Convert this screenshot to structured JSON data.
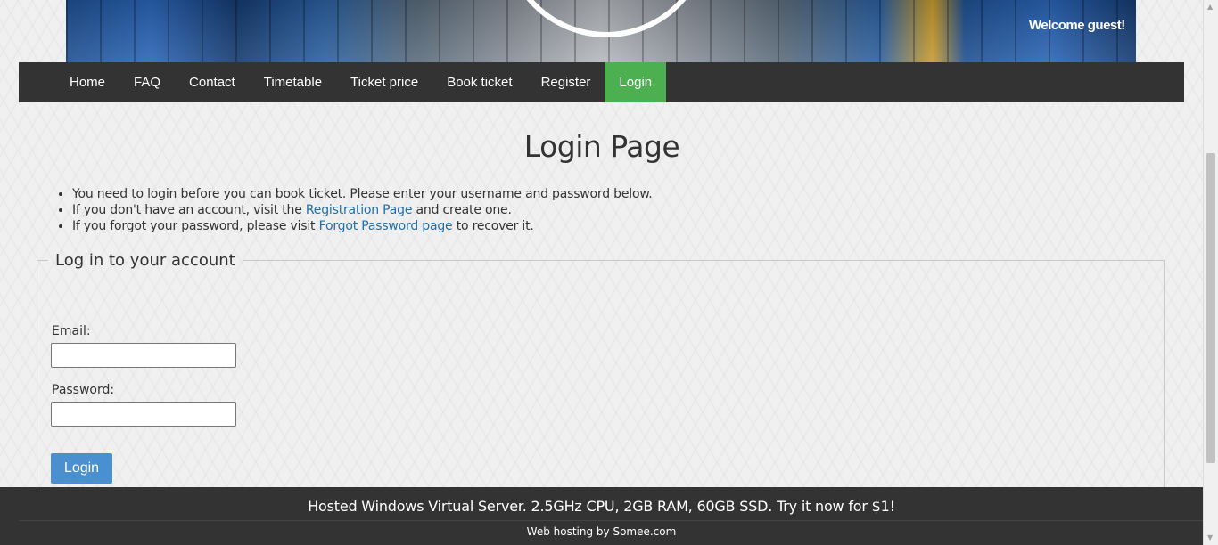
{
  "header": {
    "welcome_text": "Welcome guest!"
  },
  "nav": {
    "items": [
      {
        "label": "Home"
      },
      {
        "label": "FAQ"
      },
      {
        "label": "Contact"
      },
      {
        "label": "Timetable"
      },
      {
        "label": "Ticket price"
      },
      {
        "label": "Book ticket"
      },
      {
        "label": "Register"
      },
      {
        "label": "Login",
        "active": true
      }
    ],
    "active_color": "#4caf50",
    "bar_color": "#333333"
  },
  "main": {
    "title": "Login Page",
    "info": {
      "line1": "You need to login before you can book ticket. Please enter your username and password below.",
      "line2_pre": "If you don't have an account, visit the ",
      "line2_link": "Registration Page",
      "line2_post": " and create one.",
      "line3_pre": "If you forgot your password, please visit ",
      "line3_link": "Forgot Password page",
      "line3_post": " to recover it."
    },
    "form": {
      "legend": "Log in to your account",
      "email_label": "Email:",
      "email_value": "",
      "password_label": "Password:",
      "password_value": "",
      "submit_label": "Login"
    }
  },
  "footer": {
    "ad_text": "Hosted Windows Virtual Server. 2.5GHz CPU, 2GB RAM, 60GB SSD. Try it now for $1!",
    "hosting_text": "Web hosting by Somee.com"
  },
  "colors": {
    "link": "#1f6fa8",
    "button": "#4a8fd0"
  }
}
